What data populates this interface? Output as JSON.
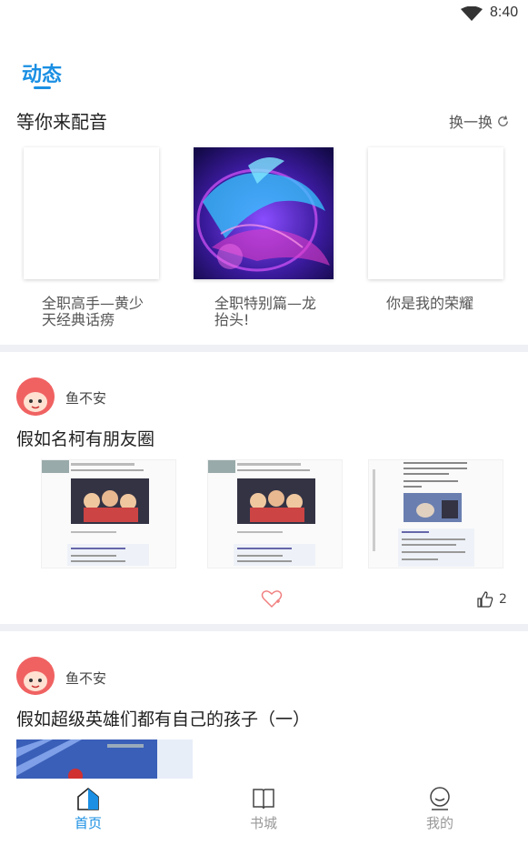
{
  "status_bar": {
    "time": "8:40",
    "wifi_icon": "wifi-icon"
  },
  "header": {
    "tab_title": "动态"
  },
  "dub_section": {
    "title": "等你来配音",
    "refresh_label": "换一换",
    "refresh_icon": "refresh-icon",
    "cards": [
      {
        "label_line1": "全职高手—黄少",
        "label_line2": "天经典话痨"
      },
      {
        "label_line1": "全职特别篇—龙",
        "label_line2": "抬头!"
      },
      {
        "label_line1": "你是我的荣耀",
        "label_line2": ""
      }
    ]
  },
  "posts": [
    {
      "username": "鱼不安",
      "title": "假如名柯有朋友圈",
      "like_count": "2"
    },
    {
      "username": "鱼不安",
      "title": "假如超级英雄们都有自己的孩子（一）"
    }
  ],
  "bottom_nav": {
    "items": [
      {
        "label": "首页",
        "icon": "home-icon",
        "active": true
      },
      {
        "label": "书城",
        "icon": "book-icon",
        "active": false
      },
      {
        "label": "我的",
        "icon": "profile-icon",
        "active": false
      }
    ]
  },
  "colors": {
    "accent": "#1a8fe3",
    "divider": "#eef0f6",
    "heart": "#f08080"
  }
}
